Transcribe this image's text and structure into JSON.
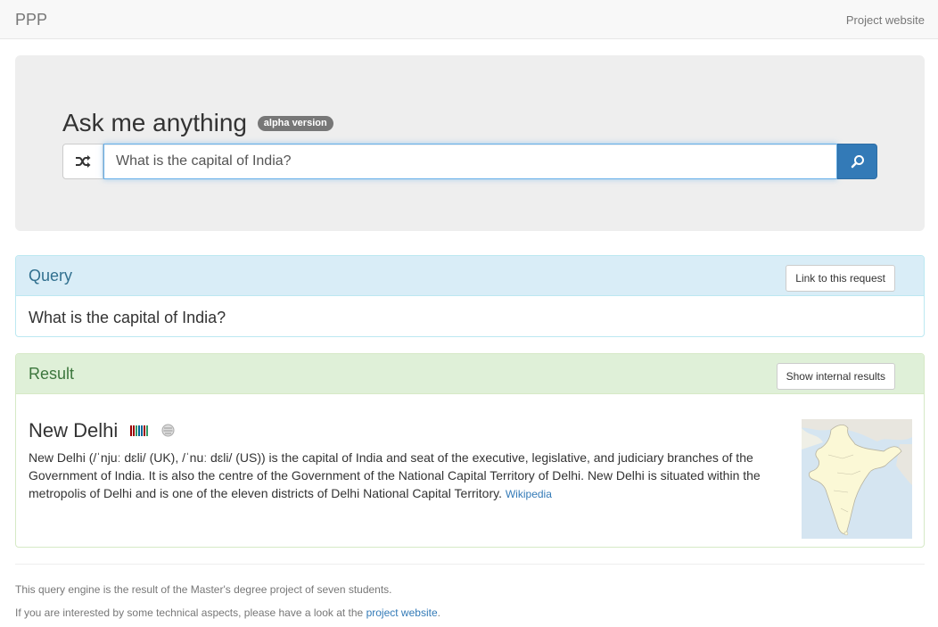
{
  "navbar": {
    "brand": "PPP",
    "project_link": "Project website"
  },
  "search": {
    "title": "Ask me anything",
    "badge": "alpha version",
    "value": "What is the capital of India?",
    "shuffle_icon": "shuffle-icon",
    "search_icon": "search-icon",
    "accent": "#337ab7"
  },
  "query_panel": {
    "title": "Query",
    "link_button": "Link to this request",
    "text": "What is the capital of India?"
  },
  "result_panel": {
    "title": "Result",
    "internal_button": "Show internal results",
    "entity": "New Delhi",
    "wikidata_icon": "wikidata-icon",
    "wikipedia_icon": "wikipedia-icon",
    "description": "New Delhi (/ˈnjuː dɛli/ (UK), /ˈnuː dɛli/ (US)) is the capital of India and seat of the executive, legislative, and judiciary branches of the Government of India. It is also the centre of the Government of the National Capital Territory of Delhi. New Delhi is situated within the metropolis of Delhi and is one of the eleven districts of Delhi National Capital Territory.",
    "source_link": "Wikipedia",
    "image": "india-map"
  },
  "footer": {
    "line1": "This query engine is the result of the Master's degree project of seven students.",
    "line2_prefix": "If you are interested by some technical aspects, please have a look at the",
    "line2_link": "project website",
    "line2_suffix": "."
  }
}
